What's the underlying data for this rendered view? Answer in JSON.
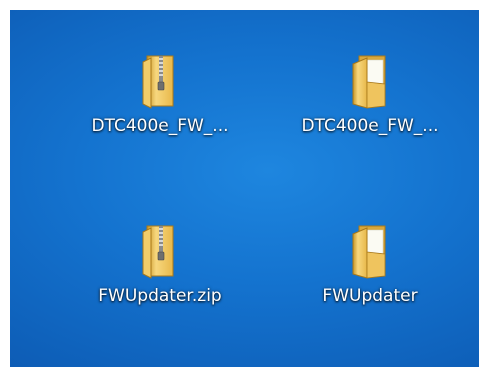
{
  "desktop": {
    "background_color": "#1473cf",
    "icons": [
      {
        "label": "DTC400e_FW_...",
        "icon": "zip-folder-icon"
      },
      {
        "label": "DTC400e_FW_...",
        "icon": "folder-icon"
      },
      {
        "label": "FWUpdater.zip",
        "icon": "zip-folder-icon"
      },
      {
        "label": "FWUpdater",
        "icon": "folder-icon"
      }
    ]
  }
}
